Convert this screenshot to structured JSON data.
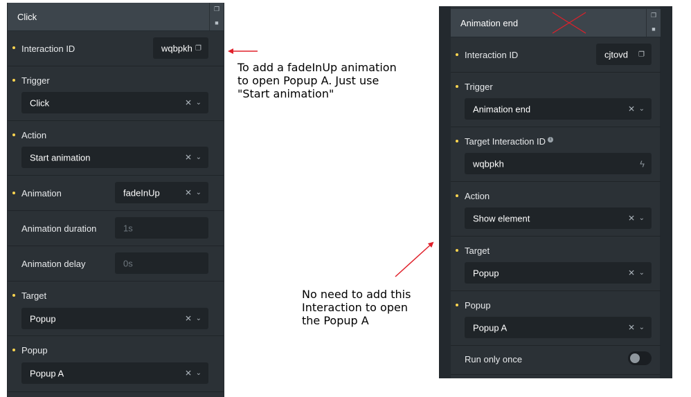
{
  "left_panel": {
    "title": "Click",
    "interaction_id": {
      "label": "Interaction ID",
      "value": "wqbpkh"
    },
    "trigger": {
      "label": "Trigger",
      "value": "Click"
    },
    "action": {
      "label": "Action",
      "value": "Start animation"
    },
    "animation": {
      "label": "Animation",
      "value": "fadeInUp"
    },
    "animation_duration": {
      "label": "Animation duration",
      "placeholder": "1s"
    },
    "animation_delay": {
      "label": "Animation delay",
      "placeholder": "0s"
    },
    "target": {
      "label": "Target",
      "value": "Popup"
    },
    "popup": {
      "label": "Popup",
      "value": "Popup A"
    }
  },
  "right_panel": {
    "title": "Animation end",
    "interaction_id": {
      "label": "Interaction ID",
      "value": "cjtovd"
    },
    "trigger": {
      "label": "Trigger",
      "value": "Animation end"
    },
    "target_interaction_id": {
      "label": "Target Interaction ID",
      "value": "wqbpkh"
    },
    "action": {
      "label": "Action",
      "value": "Show element"
    },
    "target": {
      "label": "Target",
      "value": "Popup"
    },
    "popup": {
      "label": "Popup",
      "value": "Popup A"
    },
    "run_only_once": {
      "label": "Run only once",
      "enabled": false
    }
  },
  "annotations": {
    "note_1": [
      "To add a fadeInUp animation",
      "to open Popup A. Just use",
      "\"Start animation\""
    ],
    "note_2": [
      "No need to add this",
      "Interaction to open",
      "the Popup A"
    ]
  },
  "icons": {
    "copy": "copy-icon",
    "trash": "trash-icon",
    "clear": "clear-icon",
    "chevron": "chevron-down-icon",
    "bolt": "bolt-icon",
    "info": "info-icon"
  },
  "colors": {
    "panel_bg": "#2b3136",
    "header_bg": "#3d454c",
    "field_bg": "#1f2428",
    "bullet": "#ffd64f",
    "annotation_red": "#e0202a"
  }
}
